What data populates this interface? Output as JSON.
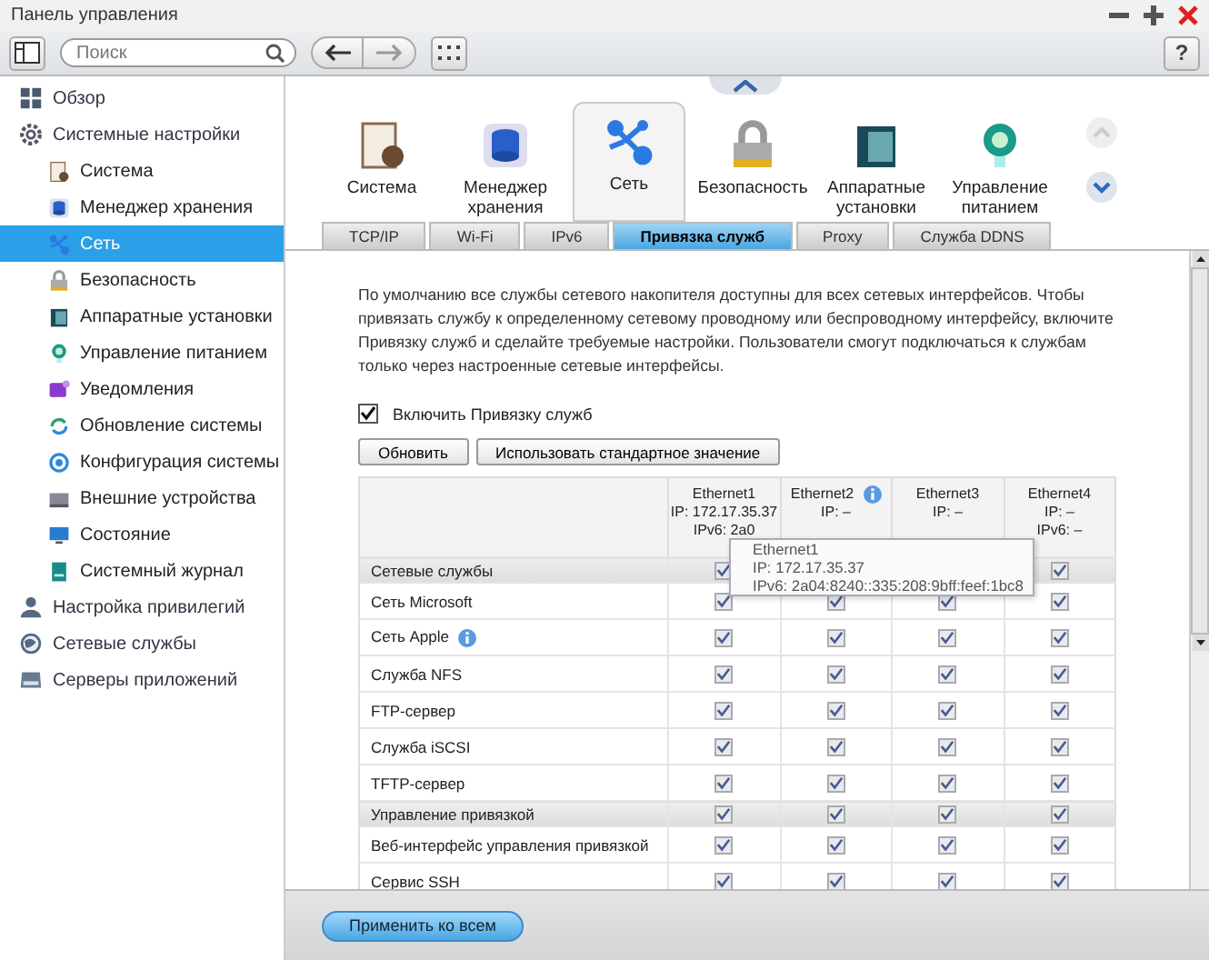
{
  "window": {
    "title": "Панель управления"
  },
  "toolbar": {
    "search": {
      "placeholder": "Поиск"
    },
    "help": "?"
  },
  "sidebar": {
    "items": [
      {
        "label": "Обзор",
        "selected": false
      },
      {
        "label": "Системные настройки",
        "selected": false,
        "children": [
          {
            "label": "Система",
            "selected": false
          },
          {
            "label": "Менеджер хранения",
            "selected": false
          },
          {
            "label": "Сеть",
            "selected": true
          },
          {
            "label": "Безопасность",
            "selected": false
          },
          {
            "label": "Аппаратные установки",
            "selected": false
          },
          {
            "label": "Управление питанием",
            "selected": false
          },
          {
            "label": "Уведомления",
            "selected": false
          },
          {
            "label": "Обновление системы",
            "selected": false
          },
          {
            "label": "Конфигурация системы",
            "selected": false
          },
          {
            "label": "Внешние устройства",
            "selected": false
          },
          {
            "label": "Состояние",
            "selected": false
          },
          {
            "label": "Системный журнал",
            "selected": false
          }
        ]
      },
      {
        "label": "Настройка привилегий",
        "selected": false
      },
      {
        "label": "Сетевые службы",
        "selected": false
      },
      {
        "label": "Серверы приложений",
        "selected": false
      }
    ]
  },
  "modules": [
    {
      "label": "Система",
      "selected": false
    },
    {
      "label": "Менеджер хранения",
      "selected": false
    },
    {
      "label": "Сеть",
      "selected": true
    },
    {
      "label": "Безопасность",
      "selected": false
    },
    {
      "label": "Аппаратные установки",
      "selected": false
    },
    {
      "label": "Управление питанием",
      "selected": false
    }
  ],
  "tabs": [
    {
      "label": "TCP/IP",
      "selected": false
    },
    {
      "label": "Wi-Fi",
      "selected": false
    },
    {
      "label": "IPv6",
      "selected": false
    },
    {
      "label": "Привязка служб",
      "selected": true
    },
    {
      "label": "Proxy",
      "selected": false
    },
    {
      "label": "Служба DDNS",
      "selected": false
    }
  ],
  "description": "По умолчанию все службы сетевого накопителя доступны для всех сетевых интерфейсов. Чтобы привязать службу к определенному сетевому проводному или беспроводному интерфейсу, включите Привязку служб и сделайте требуемые настройки. Пользователи смогут подключаться к службам только через настроенные сетевые интерфейсы.",
  "enable": {
    "label": "Включить Привязку служб",
    "checked": true
  },
  "buttons": [
    "Обновить",
    "Использовать стандартное значение"
  ],
  "table": {
    "columns": [
      {
        "lines": [
          "Ethernet1",
          "IP: 172.17.35.37",
          "IPv6: 2a0"
        ],
        "info": false
      },
      {
        "lines": [
          "Ethernet2",
          "IP: –"
        ],
        "info": true
      },
      {
        "lines": [
          "Ethernet3",
          "IP: –"
        ],
        "info": false
      },
      {
        "lines": [
          "Ethernet4",
          "IP: –",
          "IPv6: –"
        ],
        "info": false
      }
    ],
    "rows": [
      {
        "name": "Сетевые службы",
        "kind": "group",
        "info": false,
        "checks": [
          {
            "checked": true
          },
          {
            "checked": true
          }
        ]
      },
      {
        "name": "Сеть Microsoft",
        "kind": "service",
        "info": false,
        "checks": [
          {
            "checked": true
          },
          {
            "checked": true
          },
          {
            "checked": true
          },
          {
            "checked": true
          }
        ]
      },
      {
        "name": "Сеть Apple",
        "kind": "service",
        "info": true,
        "checks": [
          {
            "checked": true
          },
          {
            "checked": true
          },
          {
            "checked": true
          },
          {
            "checked": true
          }
        ]
      },
      {
        "name": "Служба NFS",
        "kind": "service",
        "info": false,
        "checks": [
          {
            "checked": true
          },
          {
            "checked": true
          },
          {
            "checked": true
          },
          {
            "checked": true
          }
        ]
      },
      {
        "name": "FTP-сервер",
        "kind": "service",
        "info": false,
        "checks": [
          {
            "checked": true
          },
          {
            "checked": true
          },
          {
            "checked": true
          },
          {
            "checked": true
          }
        ]
      },
      {
        "name": "Служба iSCSI",
        "kind": "service",
        "info": false,
        "checks": [
          {
            "checked": true
          },
          {
            "checked": true
          },
          {
            "checked": true
          },
          {
            "checked": true
          }
        ]
      },
      {
        "name": "TFTP-сервер",
        "kind": "service",
        "info": false,
        "checks": [
          {
            "checked": true
          },
          {
            "checked": true
          },
          {
            "checked": true
          },
          {
            "checked": true
          }
        ]
      },
      {
        "name": "Управление привязкой",
        "kind": "group",
        "info": false,
        "checks": [
          {
            "checked": true
          },
          {
            "checked": true
          },
          {
            "checked": true
          },
          {
            "checked": true
          }
        ]
      },
      {
        "name": "Веб-интерфейс управления привязкой",
        "kind": "service",
        "info": false,
        "checks": [
          {
            "checked": true
          },
          {
            "checked": true
          },
          {
            "checked": true
          },
          {
            "checked": true
          }
        ]
      },
      {
        "name": "Сервис SSH",
        "kind": "service",
        "info": false,
        "checks": [
          {
            "checked": true
          },
          {
            "checked": true
          },
          {
            "checked": true
          },
          {
            "checked": true
          }
        ]
      }
    ]
  },
  "tooltip": {
    "lines": [
      "Ethernet1",
      "IP: 172.17.35.37",
      "IPv6: 2a04:8240::335:208:9bff:feef:1bc8"
    ]
  },
  "footer": {
    "apply": "Применить ко всем"
  }
}
